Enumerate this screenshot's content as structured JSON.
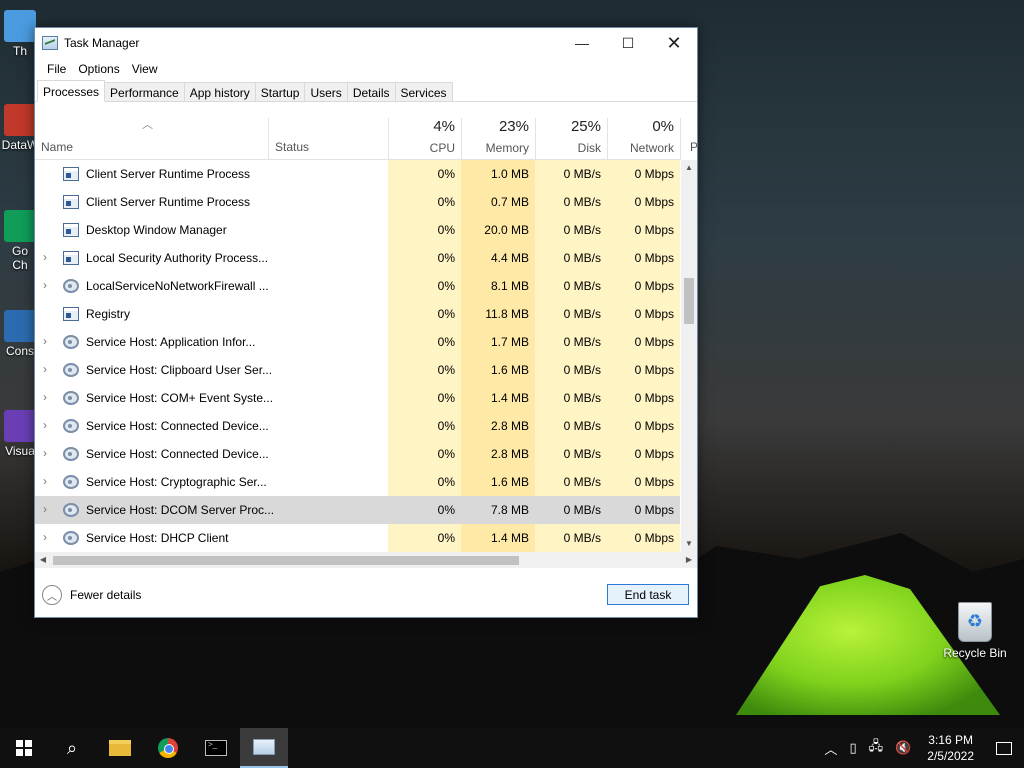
{
  "desktop": {
    "icons": [
      {
        "label": "Th",
        "name": "this-pc"
      },
      {
        "label": "DataW",
        "name": "datawrapper"
      },
      {
        "label": "Go\nCh",
        "name": "google-chrome"
      },
      {
        "label": "Cons",
        "name": "console"
      },
      {
        "label": "Visua",
        "name": "visual-studio"
      }
    ],
    "recycle_bin": "Recycle Bin"
  },
  "window": {
    "title": "Task Manager",
    "controls": {
      "minimize": "—",
      "maximize": "☐",
      "close": "✕"
    }
  },
  "menu": [
    "File",
    "Options",
    "View"
  ],
  "tabs": [
    "Processes",
    "Performance",
    "App history",
    "Startup",
    "Users",
    "Details",
    "Services"
  ],
  "active_tab": "Processes",
  "columns": {
    "name": "Name",
    "status": "Status",
    "cpu": {
      "pct": "4%",
      "label": "CPU"
    },
    "memory": {
      "pct": "23%",
      "label": "Memory"
    },
    "disk": {
      "pct": "25%",
      "label": "Disk"
    },
    "network": {
      "pct": "0%",
      "label": "Network"
    },
    "extra": "P"
  },
  "processes": [
    {
      "name": "Client Server Runtime Process",
      "expandable": false,
      "icon": "window",
      "cpu": "0%",
      "memory": "1.0 MB",
      "disk": "0 MB/s",
      "network": "0 Mbps"
    },
    {
      "name": "Client Server Runtime Process",
      "expandable": false,
      "icon": "window",
      "cpu": "0%",
      "memory": "0.7 MB",
      "disk": "0 MB/s",
      "network": "0 Mbps"
    },
    {
      "name": "Desktop Window Manager",
      "expandable": false,
      "icon": "window",
      "cpu": "0%",
      "memory": "20.0 MB",
      "disk": "0 MB/s",
      "network": "0 Mbps"
    },
    {
      "name": "Local Security Authority Process...",
      "expandable": true,
      "icon": "window",
      "cpu": "0%",
      "memory": "4.4 MB",
      "disk": "0 MB/s",
      "network": "0 Mbps"
    },
    {
      "name": "LocalServiceNoNetworkFirewall ...",
      "expandable": true,
      "icon": "gear",
      "cpu": "0%",
      "memory": "8.1 MB",
      "disk": "0 MB/s",
      "network": "0 Mbps"
    },
    {
      "name": "Registry",
      "expandable": false,
      "icon": "window",
      "cpu": "0%",
      "memory": "11.8 MB",
      "disk": "0 MB/s",
      "network": "0 Mbps"
    },
    {
      "name": "Service Host: Application Infor...",
      "expandable": true,
      "icon": "gear",
      "cpu": "0%",
      "memory": "1.7 MB",
      "disk": "0 MB/s",
      "network": "0 Mbps"
    },
    {
      "name": "Service Host: Clipboard User Ser...",
      "expandable": true,
      "icon": "gear",
      "cpu": "0%",
      "memory": "1.6 MB",
      "disk": "0 MB/s",
      "network": "0 Mbps"
    },
    {
      "name": "Service Host: COM+ Event Syste...",
      "expandable": true,
      "icon": "gear",
      "cpu": "0%",
      "memory": "1.4 MB",
      "disk": "0 MB/s",
      "network": "0 Mbps"
    },
    {
      "name": "Service Host: Connected Device...",
      "expandable": true,
      "icon": "gear",
      "cpu": "0%",
      "memory": "2.8 MB",
      "disk": "0 MB/s",
      "network": "0 Mbps"
    },
    {
      "name": "Service Host: Connected Device...",
      "expandable": true,
      "icon": "gear",
      "cpu": "0%",
      "memory": "2.8 MB",
      "disk": "0 MB/s",
      "network": "0 Mbps"
    },
    {
      "name": "Service Host: Cryptographic Ser...",
      "expandable": true,
      "icon": "gear",
      "cpu": "0%",
      "memory": "1.6 MB",
      "disk": "0 MB/s",
      "network": "0 Mbps"
    },
    {
      "name": "Service Host: DCOM Server Proc...",
      "expandable": true,
      "icon": "gear",
      "cpu": "0%",
      "memory": "7.8 MB",
      "disk": "0 MB/s",
      "network": "0 Mbps",
      "selected": true
    },
    {
      "name": "Service Host: DHCP Client",
      "expandable": true,
      "icon": "gear",
      "cpu": "0%",
      "memory": "1.4 MB",
      "disk": "0 MB/s",
      "network": "0 Mbps"
    }
  ],
  "footer": {
    "fewer_details": "Fewer details",
    "end_task": "End task"
  },
  "taskbar": {
    "apps": [
      "start-icon",
      "search-icon",
      "file-explorer-icon",
      "chrome-icon",
      "command-prompt-icon",
      "task-manager-icon"
    ],
    "time": "3:16 PM",
    "date": "2/5/2022"
  }
}
